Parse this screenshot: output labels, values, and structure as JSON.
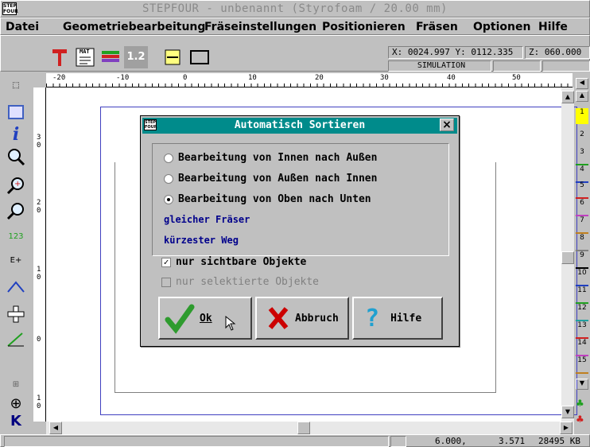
{
  "window": {
    "title": "STEPFOUR - unbenannt (Styrofoam / 20.00 mm)",
    "sys_icon_text": "STEP FOUR"
  },
  "menu": {
    "items": [
      "Datei",
      "Geometriebearbeitung",
      "Fräseinstellungen",
      "Positionieren",
      "Fräsen",
      "Optionen",
      "Hilfe"
    ]
  },
  "toolbar": {
    "mat_label": "MAT",
    "zoom_label": "1.2"
  },
  "coords": {
    "x": "X: 0024.997",
    "y": "Y: 0112.335",
    "z": "Z: 060.000",
    "mode": "SIMULATION"
  },
  "ruler": {
    "ticks": [
      "-20",
      "-10",
      "0",
      "10",
      "20",
      "30",
      "40",
      "50"
    ]
  },
  "vruler": {
    "ticks": [
      "3",
      "0",
      "2",
      "0",
      "1",
      "0",
      "0",
      "1",
      "0"
    ]
  },
  "rightbar": {
    "numbers": [
      "1",
      "2",
      "3",
      "4",
      "5",
      "6",
      "7",
      "8",
      "9",
      "10",
      "11",
      "12",
      "13",
      "14",
      "15"
    ]
  },
  "dialog": {
    "title": "Automatisch Sortieren",
    "close": "×",
    "options": [
      "Bearbeitung von Innen nach Außen",
      "Bearbeitung von Außen nach Innen",
      "Bearbeitung von Oben nach Unten"
    ],
    "selected_option": 2,
    "link1": "gleicher Fräser",
    "link2": "kürzester Weg",
    "checkbox1": "nur sichtbare Objekte",
    "checkbox1_checked": true,
    "checkbox2": "nur selektierte Objekte",
    "checkbox2_checked": false,
    "btn_ok": "Ok",
    "btn_cancel": "Abbruch",
    "btn_help": "Hilfe"
  },
  "status": {
    "pos_x": "6.000,",
    "pos_y": "3.571",
    "memory": "28495 KB"
  },
  "colors": {
    "dialog_title": "#008b8b",
    "link": "#00008b",
    "ok_check": "#2e9b2e",
    "cancel_x": "#cc0000",
    "help_q": "#20a0d0"
  }
}
